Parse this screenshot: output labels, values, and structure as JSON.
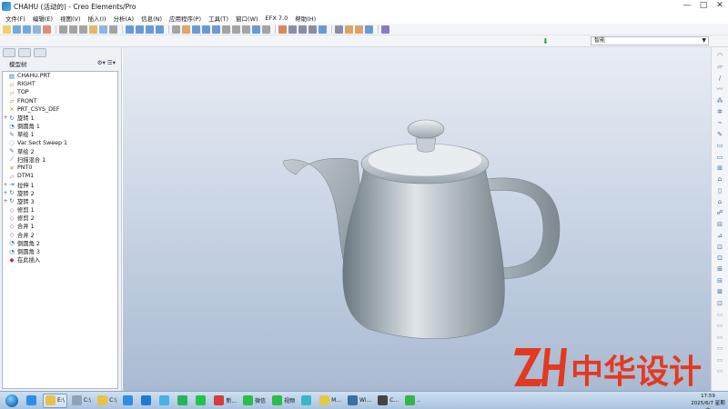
{
  "window": {
    "title": "CHAHU (活动的) - Creo Elements/Pro",
    "min": "—",
    "max": "□",
    "close": "✕"
  },
  "menu": [
    "文件(F)",
    "编辑(E)",
    "视图(V)",
    "插入(I)",
    "分析(A)",
    "信息(N)",
    "应用程序(P)",
    "工具(T)",
    "窗口(W)",
    "EFX 7.0",
    "帮助(H)"
  ],
  "filter": {
    "value": "智能",
    "arrow": "▼"
  },
  "model_tree": {
    "title": "模型树",
    "tools": "⚙▾ ☰▾",
    "items": [
      {
        "expand": "",
        "icon": "▤",
        "label": "CHAHU.PRT",
        "color": "#2a6fb5"
      },
      {
        "expand": "",
        "icon": "▱",
        "label": "RIGHT",
        "color": "#d17a1a"
      },
      {
        "expand": "",
        "icon": "▱",
        "label": "TOP",
        "color": "#d17a1a"
      },
      {
        "expand": "",
        "icon": "▱",
        "label": "FRONT",
        "color": "#d17a1a"
      },
      {
        "expand": "",
        "icon": "⨯",
        "label": "PRT_CSYS_DEF",
        "color": "#d17a1a"
      },
      {
        "expand": "+",
        "icon": "↻",
        "label": "旋转 1",
        "color": "#2a6fb5"
      },
      {
        "expand": "",
        "icon": "◔",
        "label": "倒圆角 1",
        "color": "#2a6fb5"
      },
      {
        "expand": "",
        "icon": "✎",
        "label": "草绘 1",
        "color": "#2a6fb5"
      },
      {
        "expand": "",
        "icon": "◌",
        "label": "Var Sect Sweep 1",
        "color": "#2a6fb5"
      },
      {
        "expand": "",
        "icon": "✎",
        "label": "草绘 2",
        "color": "#2a6fb5"
      },
      {
        "expand": "",
        "icon": "⟋",
        "label": "扫描混合 1",
        "color": "#2a6fb5"
      },
      {
        "expand": "",
        "icon": "✕",
        "label": "PNT0",
        "color": "#d17a1a"
      },
      {
        "expand": "",
        "icon": "▱",
        "label": "DTM1",
        "color": "#d17a1a"
      },
      {
        "expand": "+",
        "icon": "⇥",
        "label": "拉伸 1",
        "color": "#2a6fb5"
      },
      {
        "expand": "+",
        "icon": "↻",
        "label": "旋转 2",
        "color": "#2a6fb5"
      },
      {
        "expand": "+",
        "icon": "↻",
        "label": "旋转 3",
        "color": "#2a6fb5"
      },
      {
        "expand": "",
        "icon": "◇",
        "label": "修剪 1",
        "color": "#7a3fb5"
      },
      {
        "expand": "",
        "icon": "◇",
        "label": "修剪 2",
        "color": "#7a3fb5"
      },
      {
        "expand": "",
        "icon": "◇",
        "label": "合并 1",
        "color": "#7a3fb5"
      },
      {
        "expand": "",
        "icon": "◇",
        "label": "合并 2",
        "color": "#7a3fb5"
      },
      {
        "expand": "",
        "icon": "◔",
        "label": "倒圆角 2",
        "color": "#2a6fb5"
      },
      {
        "expand": "",
        "icon": "◔",
        "label": "倒圆角 3",
        "color": "#2a6fb5"
      },
      {
        "expand": "",
        "icon": "◆",
        "label": "在此插入",
        "color": "#cc2222"
      }
    ]
  },
  "taskbar": {
    "items": [
      {
        "label": "",
        "icon": "ie-icon",
        "color": "#2f8de4"
      },
      {
        "label": "E:\\",
        "icon": "folder-icon",
        "color": "#e8c04a",
        "active": true
      },
      {
        "label": "C:\\",
        "icon": "drive-icon",
        "color": "#8ea2b8"
      },
      {
        "label": "C:\\",
        "icon": "folder-icon",
        "color": "#e8c04a"
      },
      {
        "label": "",
        "icon": "search-app-icon",
        "color": "#2f8de4"
      },
      {
        "label": "",
        "icon": "k-app-icon",
        "color": "#1e7ad6"
      },
      {
        "label": "",
        "icon": "cloud-icon",
        "color": "#4ab0e8"
      },
      {
        "label": "",
        "icon": "play-icon",
        "color": "#28b45a"
      },
      {
        "label": "",
        "icon": "iqiyi-icon",
        "color": "#22c34a"
      },
      {
        "label": "新...",
        "icon": "app-icon",
        "color": "#d83b3b"
      },
      {
        "label": "微信",
        "icon": "wechat-icon",
        "color": "#2dbb4a"
      },
      {
        "label": "视频",
        "icon": "wechat-icon",
        "color": "#2dbb4a"
      },
      {
        "label": "",
        "icon": "window-icon",
        "color": "#39b6c8"
      },
      {
        "label": "M...",
        "icon": "creo-icon",
        "color": "#e3c948"
      },
      {
        "label": "Wi...",
        "icon": "windows-icon",
        "color": "#3b6fa6"
      },
      {
        "label": "C...",
        "icon": "app-icon",
        "color": "#444"
      },
      {
        "label": "..",
        "icon": "green-app-icon",
        "color": "#36b34a"
      }
    ],
    "clock_time": "17:59",
    "clock_date": "2025/6/7 星期六"
  },
  "watermark": {
    "text": "中华设计",
    "color": "#e23a22"
  }
}
